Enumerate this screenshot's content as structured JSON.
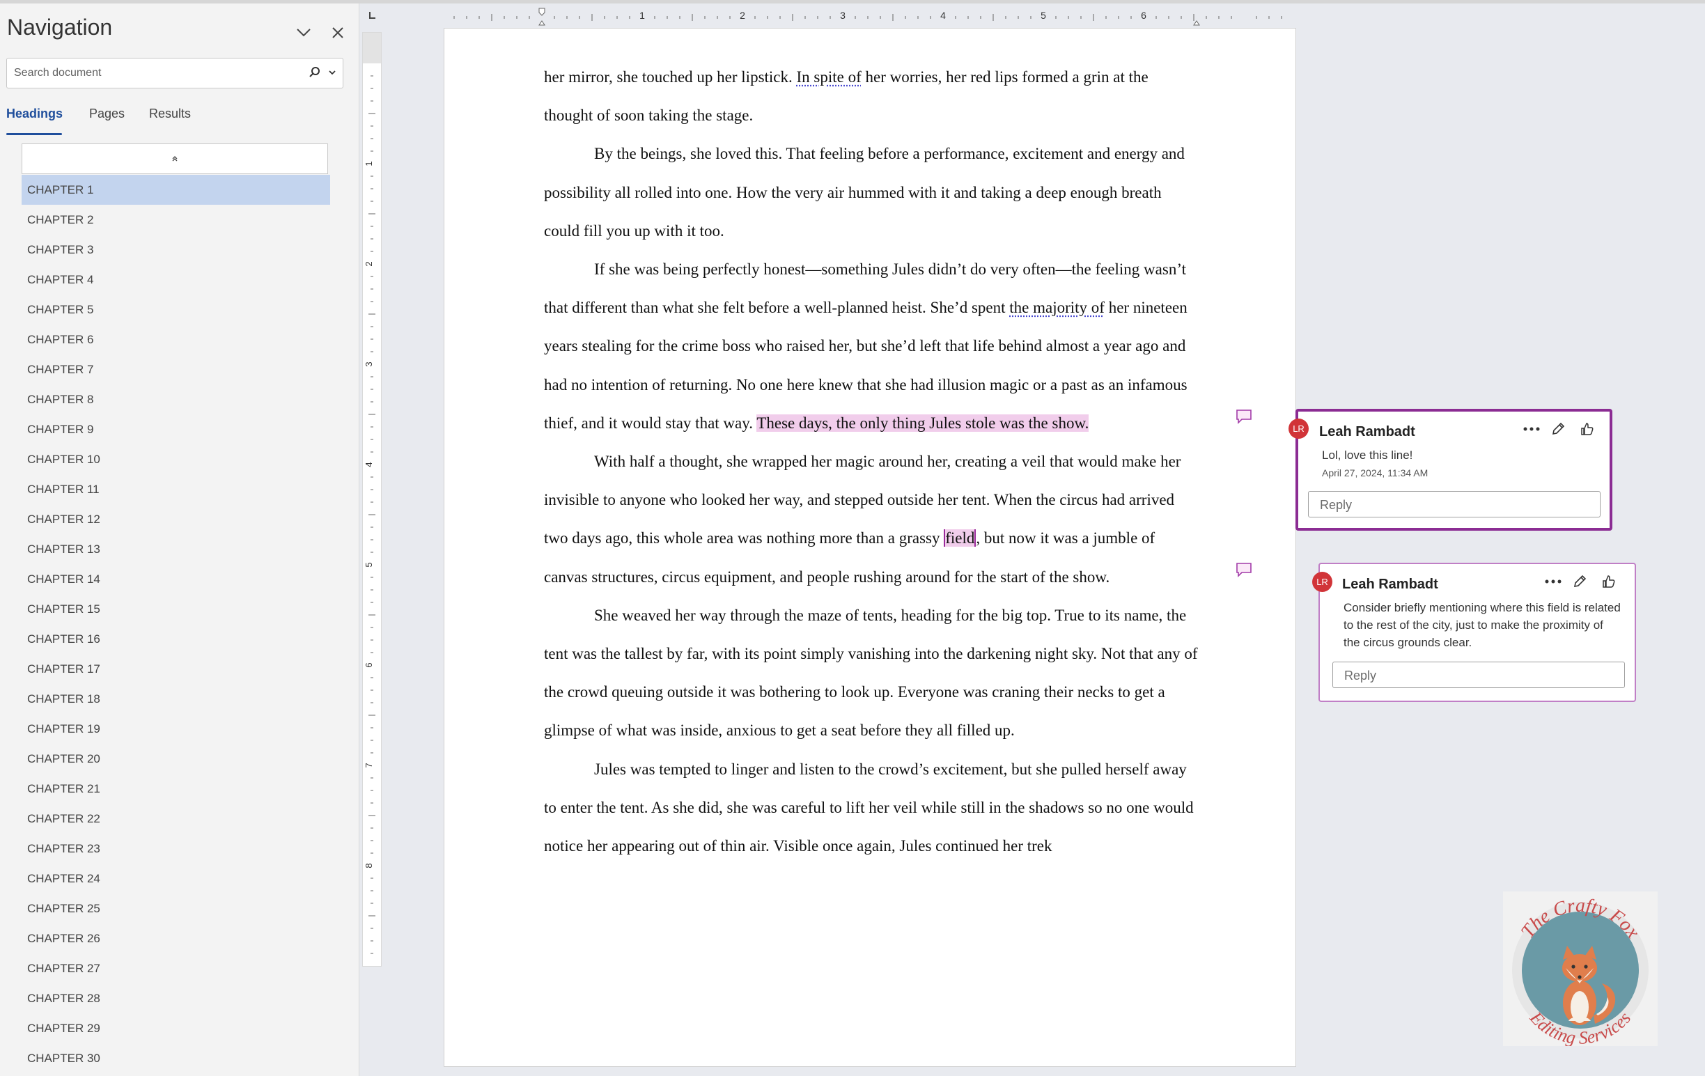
{
  "navigation": {
    "title": "Navigation",
    "search_placeholder": "Search document",
    "tabs": [
      {
        "label": "Headings",
        "active": true
      },
      {
        "label": "Pages",
        "active": false
      },
      {
        "label": "Results",
        "active": false
      }
    ],
    "headings": [
      "CHAPTER 1",
      "CHAPTER 2",
      "CHAPTER 3",
      "CHAPTER 4",
      "CHAPTER 5",
      "CHAPTER 6",
      "CHAPTER 7",
      "CHAPTER 8",
      "CHAPTER 9",
      "CHAPTER 10",
      "CHAPTER 11",
      "CHAPTER 12",
      "CHAPTER 13",
      "CHAPTER 14",
      "CHAPTER 15",
      "CHAPTER 16",
      "CHAPTER 17",
      "CHAPTER 18",
      "CHAPTER 19",
      "CHAPTER 20",
      "CHAPTER 21",
      "CHAPTER 22",
      "CHAPTER 23",
      "CHAPTER 24",
      "CHAPTER 25",
      "CHAPTER 26",
      "CHAPTER 27",
      "CHAPTER 28",
      "CHAPTER 29",
      "CHAPTER 30"
    ],
    "selected_heading": "CHAPTER 1"
  },
  "ruler": {
    "horizontal_numbers": [
      "1",
      "2",
      "3",
      "4",
      "5",
      "6"
    ],
    "vertical_numbers": [
      "1",
      "2",
      "3",
      "4",
      "5",
      "6",
      "7",
      "8"
    ]
  },
  "document": {
    "p1": {
      "a": "her mirror, she touched up her lipstick. ",
      "b": "In spite of",
      "c": " her worries, her red lips formed a grin at the thought of soon taking the stage."
    },
    "p2": "By the beings, she loved this. That feeling before a performance, excitement and energy and possibility all rolled into one. How the very air hummed with it and taking a deep enough breath could fill you up with it too.",
    "p3": {
      "a": "If she was being perfectly honest—something Jules didn’t do very often—the feeling wasn’t that different than what she felt before a well-planned heist. She’d spent ",
      "b": "the majority of",
      "c": " her nineteen years stealing for the crime boss who raised her, but she’d left that life behind almost a year ago and had no intention of returning. No one here knew that she had illusion magic or a past as an infamous thief, and it would stay that way. ",
      "d": "These days, the only thing Jules stole was the show."
    },
    "p4": {
      "a": "With half a thought, she wrapped her magic around her, creating a veil that would make her invisible to anyone who looked her way, and stepped outside her tent. When the circus had arrived two days ago, this whole area was nothing more than a grassy ",
      "b": "field",
      "c": ", but now it was a jumble of canvas structures, circus equipment, and people rushing around for the start of the show."
    },
    "p5": "She weaved her way through the maze of tents, heading for the big top. True to its name, the tent was the tallest by far, with its point simply vanishing into the darkening night sky. Not that any of the crowd queuing outside it was bothering to look up. Everyone was craning their necks to get a glimpse of what was inside, anxious to get a seat before they all filled up.",
    "p6": "Jules was tempted to linger and listen to the crowd’s excitement, but she pulled herself away to enter the tent. As she did, she was careful to lift her veil while still in the shadows so no one would notice her appearing out of thin air. Visible once again, Jules continued her trek"
  },
  "comments": [
    {
      "initials": "LR",
      "author": "Leah Rambadt",
      "text": "Lol, love this line!",
      "date": "April 27, 2024, 11:34 AM",
      "reply_placeholder": "Reply"
    },
    {
      "initials": "LR",
      "author": "Leah Rambadt",
      "text": "Consider briefly mentioning where this field is related to the rest of the city, just to make the proximity of the circus grounds clear.",
      "reply_placeholder": "Reply"
    }
  ],
  "logo": {
    "top_text": "The Crafty Fox",
    "bottom_text": "Editing Services"
  },
  "colors": {
    "accent": "#1f4e9c",
    "comment_border": "#8b2c93",
    "highlight": "#f1cdeb",
    "avatar": "#d13438"
  },
  "icons": [
    "chevron-down-icon",
    "close-icon",
    "search-icon",
    "collapse-arrow-icon",
    "comment-marker-icon",
    "more-options-icon",
    "edit-pencil-icon",
    "like-thumb-icon",
    "fox-icon"
  ]
}
